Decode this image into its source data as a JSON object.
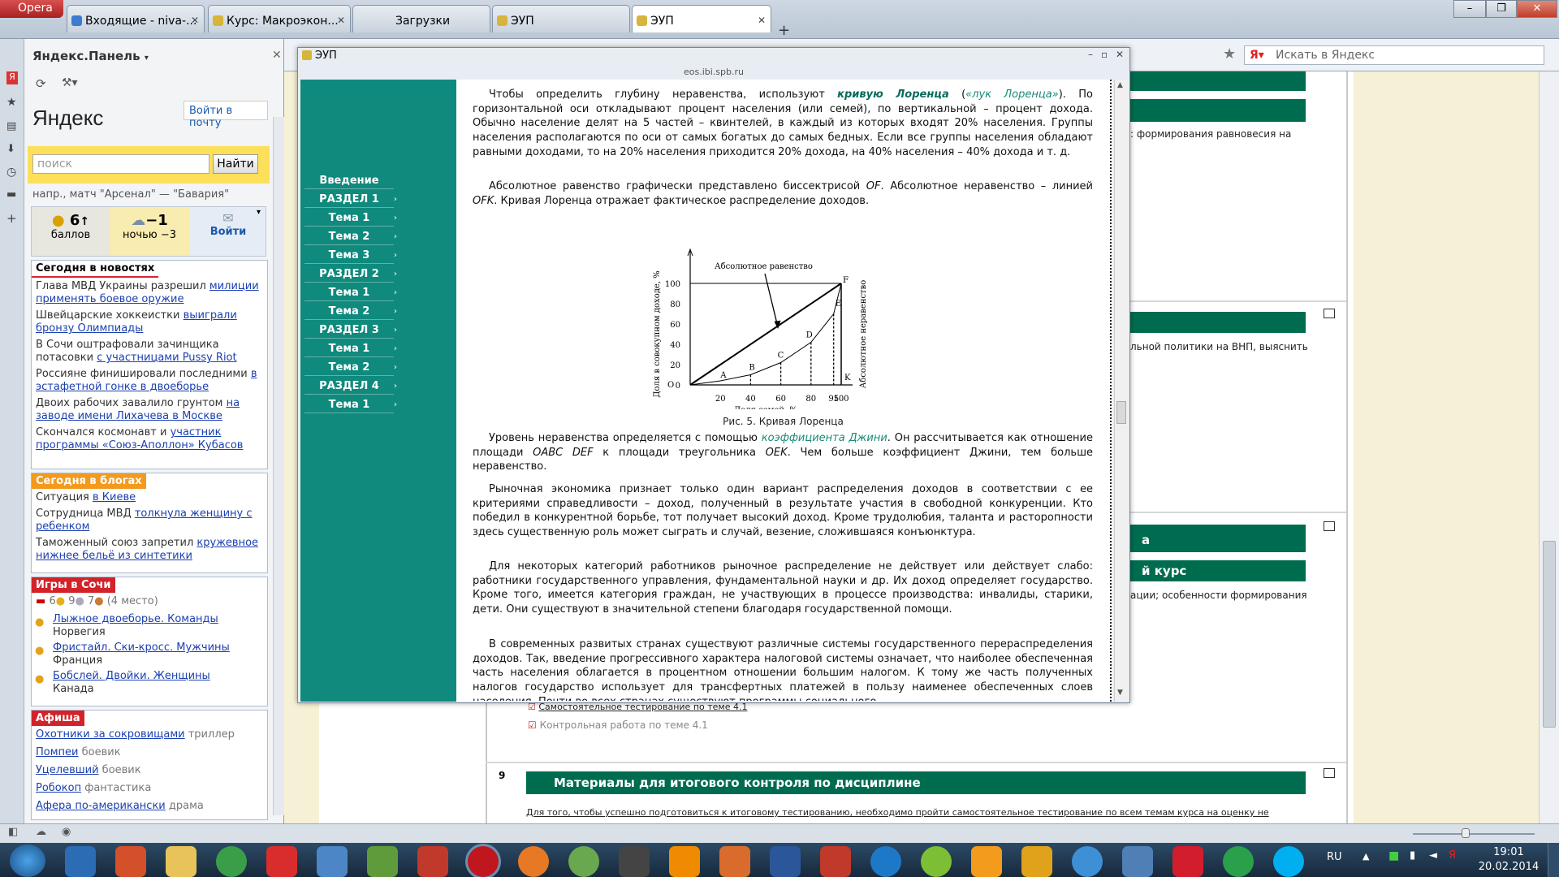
{
  "browser": {
    "menu_label": "Opera",
    "tabs": [
      {
        "label": "Входящие - niva-..."
      },
      {
        "label": "Курс: Макроэкон..."
      },
      {
        "label": "Загрузки"
      },
      {
        "label": "ЭУП"
      },
      {
        "label": "ЭУП"
      }
    ],
    "search_placeholder": "Искать в Яндекс"
  },
  "panel": {
    "title": "Яндекс.Панель",
    "logo": "Яндекс",
    "mail_link": "Войти в почту",
    "search_placeholder": "поиск",
    "search_button": "Найти",
    "hint_prefix": "напр.,",
    "hint_text": "матч \"Арсенал\" — \"Бавария\"",
    "widget_score_value": "6",
    "widget_score_label": "баллов",
    "widget_weather_value": "−1",
    "widget_weather_label": "ночью −3",
    "widget_login": "Войти",
    "news_header": "Сегодня в новостях",
    "news": [
      {
        "text": "Глава МВД Украины разрешил ",
        "link": "милиции применять боевое оружие"
      },
      {
        "text": "Швейцарские хоккеистки ",
        "link": "выиграли бронзу Олимпиады"
      },
      {
        "text": "В Сочи оштрафовали зачинщика потасовки ",
        "link": "с участницами Pussy Riot"
      },
      {
        "text": "Россияне финишировали последними ",
        "link": "в эстафетной гонке в двоеборье"
      },
      {
        "text": "Двоих рабочих завалило грунтом ",
        "link": "на заводе имени Лихачева в Москве"
      },
      {
        "text": "Скончался космонавт и ",
        "link": "участник программы «Союз-Аполлон» Кубасов"
      }
    ],
    "blogs_header": "Сегодня в блогах",
    "blogs": [
      {
        "text": "Ситуация ",
        "link": "в Киеве"
      },
      {
        "text": "Сотрудница МВД ",
        "link": "толкнула женщину с ребенком"
      },
      {
        "text": "Таможенный союз запретил ",
        "link": "кружевное нижнее бельё из синтетики"
      }
    ],
    "games_header": "Игры в Сочи",
    "medals": {
      "gold": "6",
      "silver": "9",
      "bronze": "7",
      "place": "(4 место)"
    },
    "games": [
      {
        "event": "Лыжное двоеборье. Команды",
        "winner": "Норвегия"
      },
      {
        "event": "Фристайл. Ски-кросс. Мужчины",
        "winner": "Франция"
      },
      {
        "event": "Бобслей. Двойки. Женщины",
        "winner": "Канада"
      }
    ],
    "afisha_header": "Афиша",
    "afisha": [
      {
        "title": "Охотники за сокровищами",
        "genre": "триллер"
      },
      {
        "title": "Помпеи",
        "genre": "боевик"
      },
      {
        "title": "Уцелевший",
        "genre": "боевик"
      },
      {
        "title": "Робокоп",
        "genre": "фантастика"
      },
      {
        "title": "Афера по-американски",
        "genre": "драма"
      }
    ]
  },
  "background_page": {
    "text1": ": формирования равновесия на",
    "text2": "льной политики на ВНП, выяснить",
    "bar_a": "а",
    "bar_b": "й курс",
    "text3": "ации; особенности формирования",
    "item1": "Самостоятельное тестирование по теме 4.1",
    "item2": "Контрольная работа по теме 4.1",
    "section_number": "9",
    "section_title": "Материалы для итогового контроля по дисциплине",
    "section_text": "Для того, чтобы успешно подготовиться к итоговому тестированию, необходимо пройти самостоятельное тестирование по всем темам курса на оценку не"
  },
  "modal": {
    "title": "ЭУП",
    "url": "eos.ibi.spb.ru",
    "nav": [
      "Введение",
      "РАЗДЕЛ 1",
      "Тема 1",
      "Тема 2",
      "Тема 3",
      "РАЗДЕЛ 2",
      "Тема 1",
      "Тема 2",
      "РАЗДЕЛ 3",
      "Тема 1",
      "Тема 2",
      "РАЗДЕЛ 4",
      "Тема 1"
    ],
    "p1_a": "Чтобы определить глубину неравенства, используют ",
    "p1_link": "кривую Лоренца",
    "p1_b": " (",
    "p1_link2": "«лук Лоренца»",
    "p1_c": "). По горизонтальной оси откладывают процент населения (или семей), по вертикальной – процент дохода. Обычно население делят на 5 частей – квинтелей, в каждый из которых входят 20% населения. Группы населения располагаются по оси от самых богатых до самых бедных. Если все группы населения обладают равными доходами, то на 20% населения приходится 20% дохода, на 40% населения – 40% дохода и т. д.",
    "p2_a": "Абсолютное равенство графически представлено биссектрисой ",
    "p2_of": "OF",
    "p2_b": ". Абсолютное неравенство – линией ",
    "p2_ofk": "OFK",
    "p2_c": ". Кривая Лоренца отражает фактическое распределение доходов.",
    "figure_caption": "Рис. 5. Кривая Лоренца",
    "p3_a": "Уровень неравенства определяется с помощью ",
    "p3_link": "коэффициента Джини",
    "p3_b": ". Он рассчитывается как отношение площади ",
    "p3_oabc": "OABC DEF",
    "p3_c": " к площади треугольника ",
    "p3_oek": "OEK",
    "p3_d": ". Чем больше коэффициент Джини, тем больше неравенство.",
    "p4": "Рыночная экономика признает только один вариант распределения доходов в соответствии с ее критериями справедливости – доход, полученный в результате участия в свободной конкуренции. Кто победил в конкурентной борьбе, тот получает высокий доход. Кроме трудолюбия, таланта и расторопности здесь существенную роль может сыграть и случай, везение, сложившаяся конъюнктура.",
    "p5": "Для некоторых категорий работников рыночное распределение не действует или действует слабо: работники государственного управления, фундаментальной науки и др. Их доход определяет государство. Кроме того, имеется категория граждан, не участвующих в процессе производства: инвалиды, старики, дети. Они существуют в значительной степени благодаря государственной помощи.",
    "p6": "В современных развитых странах существуют различные системы государственного перераспределения доходов. Так, введение прогрессивного характера налоговой системы означает, что наиболее обеспеченная часть населения облагается в процентном отношении большим налогом. К тому же часть полученных налогов государство использует для трансфертных платежей в пользу наименее обеспеченных слоев населения. Почти во всех странах существуют программы социального"
  },
  "chart_data": {
    "type": "line",
    "title": "Абсолютное равенство",
    "xlabel": "Доля семей, %",
    "ylabel": "Доля в совокупном доходе, %",
    "right_label": "Абсолютное неравенство",
    "x_ticks": [
      "20",
      "40",
      "60",
      "80",
      "95",
      "100"
    ],
    "y_ticks": [
      "0",
      "20",
      "40",
      "60",
      "80",
      "100"
    ],
    "origin_label": "O",
    "corner_labels": [
      "F",
      "K"
    ],
    "point_labels": [
      "A",
      "B",
      "C",
      "D",
      "E"
    ],
    "xlim": [
      0,
      100
    ],
    "ylim": [
      0,
      100
    ],
    "series": [
      {
        "name": "Абсолютное равенство",
        "x": [
          0,
          100
        ],
        "y": [
          0,
          100
        ]
      },
      {
        "name": "Кривая Лоренца",
        "x": [
          0,
          20,
          40,
          60,
          80,
          95,
          100
        ],
        "y": [
          0,
          4,
          10,
          22,
          42,
          70,
          100
        ]
      }
    ]
  },
  "status": {
    "lang": "RU",
    "time": "19:01",
    "date": "20.02.2014"
  }
}
